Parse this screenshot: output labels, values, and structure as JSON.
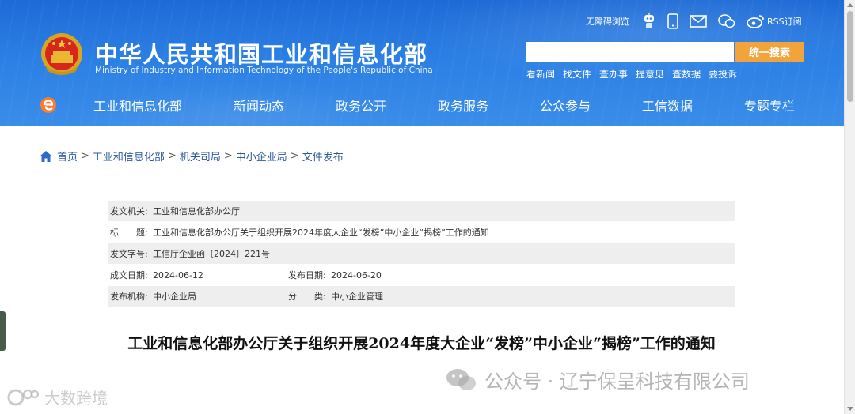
{
  "header": {
    "site_title": "中华人民共和国工业和信息化部",
    "site_subtitle": "Ministry of Industry and Information Technology of the People's Republic of China",
    "tools": {
      "accessible": "无障碍浏览",
      "rss": "RSS订阅"
    },
    "search": {
      "placeholder": "",
      "button": "统一搜索"
    },
    "quick_links": [
      "看新闻",
      "找文件",
      "查办事",
      "提意见",
      "查数据",
      "要投诉"
    ],
    "nav": [
      "工业和信息化部",
      "新闻动态",
      "政务公开",
      "政务服务",
      "公众参与",
      "工信数据",
      "专题专栏"
    ]
  },
  "breadcrumb": [
    "首页",
    "工业和信息化部",
    "机关司局",
    "中小企业局",
    "文件发布"
  ],
  "meta": {
    "issuer_label": "发文机关:",
    "issuer": "工业和信息化部办公厅",
    "title_label": "标　　题:",
    "title": "工业和信息化部办公厅关于组织开展2024年度大企业“发榜”中小企业“揭榜”工作的通知",
    "doc_no_label": "发文字号:",
    "doc_no": "工信厅企业函〔2024〕221号",
    "created_label": "成文日期:",
    "created": "2024-06-12",
    "published_label": "发布日期:",
    "published": "2024-06-20",
    "org_label": "发布机构:",
    "org": "中小企业局",
    "category_label": "分　　类:",
    "category": "中小企业管理"
  },
  "doc_title": "工业和信息化部办公厅关于组织开展2024年度大企业“发榜”中小企业“揭榜”工作的通知",
  "watermarks": {
    "right": "公众号 · 辽宁保呈科技有限公司",
    "left": "大数跨境"
  },
  "colors": {
    "header_blue": "#2b7fe4",
    "search_orange": "#f2a33a",
    "link_blue": "#2d5a9e"
  }
}
